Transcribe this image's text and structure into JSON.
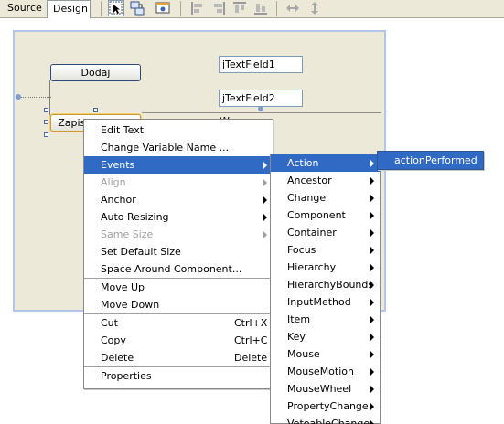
{
  "toolbar": {
    "tabs": [
      {
        "label": "Source",
        "active": false
      },
      {
        "label": "Design",
        "active": true
      }
    ],
    "icons": [
      "selection-mode-icon",
      "connection-mode-icon",
      "preview-design-icon",
      "align-left-icon",
      "align-right-icon",
      "align-top-icon",
      "align-bottom-icon",
      "resize-horizontal-icon",
      "resize-vertical-icon"
    ]
  },
  "form": {
    "button1": "Dodaj",
    "button2": "Zapisz do pliku",
    "textfield1": "jTextField1",
    "textfield2": "jTextField2",
    "partial_label": "W"
  },
  "context_menu": {
    "items": [
      {
        "label": "Edit Text"
      },
      {
        "label": "Change Variable Name ..."
      },
      {
        "label": "Events",
        "submenu": true,
        "highlighted": true
      },
      {
        "label": "Align",
        "submenu": true,
        "disabled": true
      },
      {
        "label": "Anchor",
        "submenu": true
      },
      {
        "label": "Auto Resizing",
        "submenu": true
      },
      {
        "label": "Same Size",
        "submenu": true,
        "disabled": true
      },
      {
        "label": "Set Default Size"
      },
      {
        "label": "Space Around Component..."
      },
      {
        "separator": true
      },
      {
        "label": "Move Up"
      },
      {
        "label": "Move Down"
      },
      {
        "separator": true
      },
      {
        "label": "Cut",
        "shortcut": "Ctrl+X"
      },
      {
        "label": "Copy",
        "shortcut": "Ctrl+C"
      },
      {
        "label": "Delete",
        "shortcut": "Delete"
      },
      {
        "separator": true
      },
      {
        "label": "Properties"
      }
    ]
  },
  "events_menu": {
    "items": [
      {
        "label": "Action",
        "highlighted": true
      },
      {
        "label": "Ancestor"
      },
      {
        "label": "Change"
      },
      {
        "label": "Component"
      },
      {
        "label": "Container"
      },
      {
        "label": "Focus"
      },
      {
        "label": "Hierarchy"
      },
      {
        "label": "HierarchyBounds"
      },
      {
        "label": "InputMethod"
      },
      {
        "label": "Item"
      },
      {
        "label": "Key"
      },
      {
        "label": "Mouse"
      },
      {
        "label": "MouseMotion"
      },
      {
        "label": "MouseWheel"
      },
      {
        "label": "PropertyChange"
      },
      {
        "label": "VetoableChange"
      }
    ]
  },
  "action_menu": {
    "items": [
      {
        "label": "actionPerformed",
        "highlighted": true
      }
    ]
  },
  "colors": {
    "menu_highlight": "#316ac5",
    "form_background": "#ece9d8",
    "form_border": "#b3c5e8"
  }
}
